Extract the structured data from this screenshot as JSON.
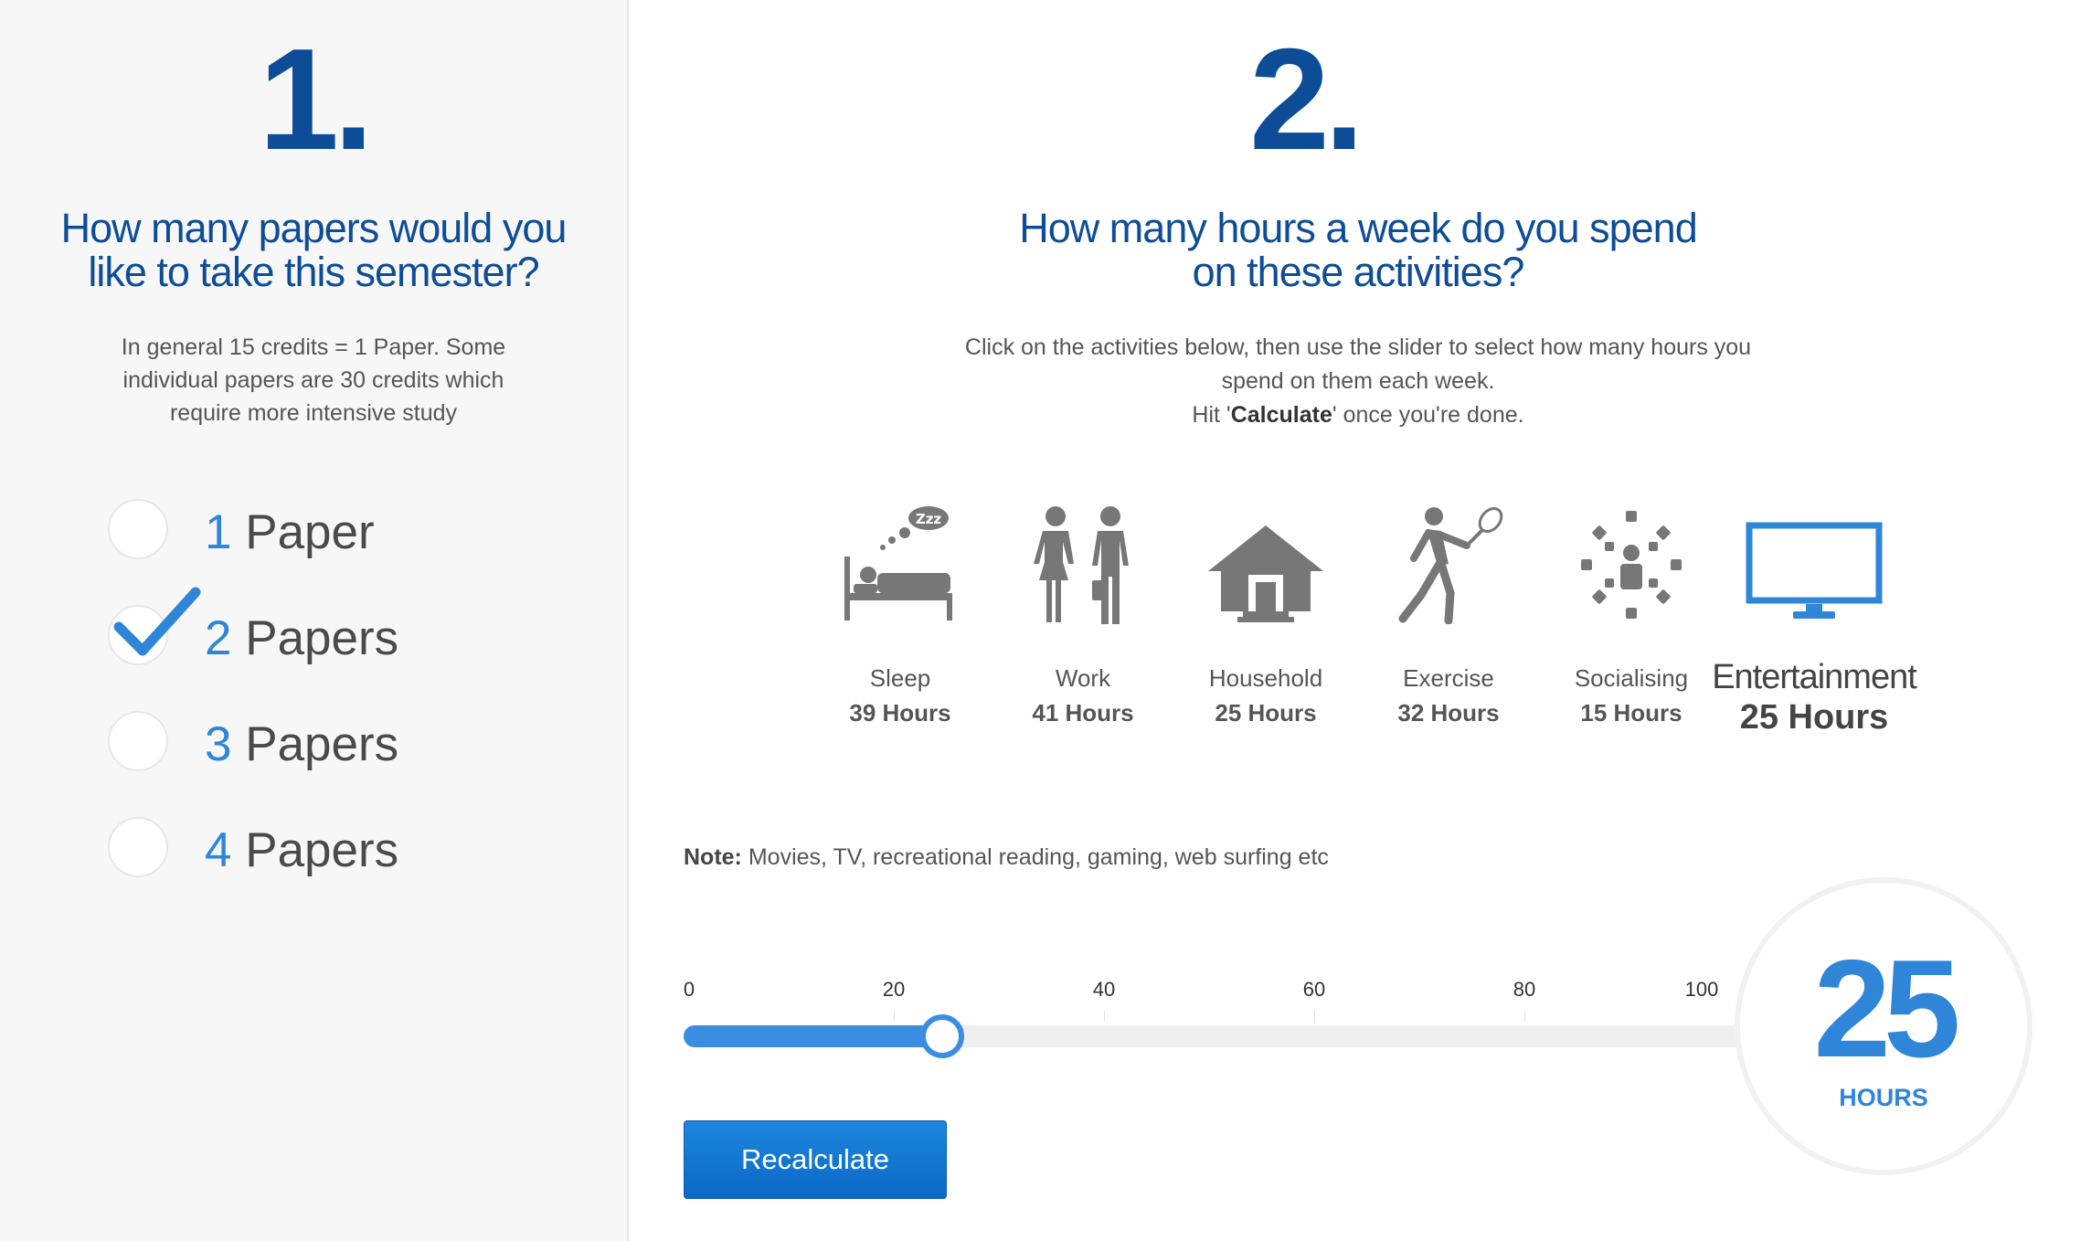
{
  "left": {
    "step": "1.",
    "question": "How many papers would you like to take this semester?",
    "hint": "In general 15 credits = 1 Paper. Some individual papers are 30 credits which require more intensive study",
    "options": [
      {
        "number": "1",
        "label": "Paper",
        "selected": false
      },
      {
        "number": "2",
        "label": "Papers",
        "selected": true
      },
      {
        "number": "3",
        "label": "Papers",
        "selected": false
      },
      {
        "number": "4",
        "label": "Papers",
        "selected": false
      }
    ]
  },
  "right": {
    "step": "2.",
    "question": "How many hours a week do you spend on these activities?",
    "hint_line1": "Click on the activities below, then use the slider to select how many hours you spend on them each week.",
    "hint_prefix": "Hit '",
    "hint_bold": "Calculate",
    "hint_suffix": "' once you're done.",
    "activities": [
      {
        "name": "Sleep",
        "hours": "39 Hours",
        "icon": "bed-icon"
      },
      {
        "name": "Work",
        "hours": "41 Hours",
        "icon": "business-people-icon"
      },
      {
        "name": "Household",
        "hours": "25 Hours",
        "icon": "house-icon"
      },
      {
        "name": "Exercise",
        "hours": "32 Hours",
        "icon": "tennis-player-icon"
      },
      {
        "name": "Socialising",
        "hours": "15 Hours",
        "icon": "group-table-icon"
      },
      {
        "name": "Entertainment",
        "hours": "25 Hours",
        "icon": "monitor-icon",
        "selected": true
      }
    ],
    "note_label": "Note:",
    "note_text": " Movies, TV, recreational reading, gaming, web surfing etc",
    "slider": {
      "min": 0,
      "max": 100,
      "value": 25,
      "labels": [
        "0",
        "20",
        "40",
        "60",
        "80",
        "100"
      ]
    },
    "button_label": "Recalculate",
    "display_value": "25",
    "display_unit": "HOURS",
    "colors": {
      "accent": "#2f86d8",
      "heading": "#0d4d97",
      "icon_gray": "#777777"
    }
  }
}
